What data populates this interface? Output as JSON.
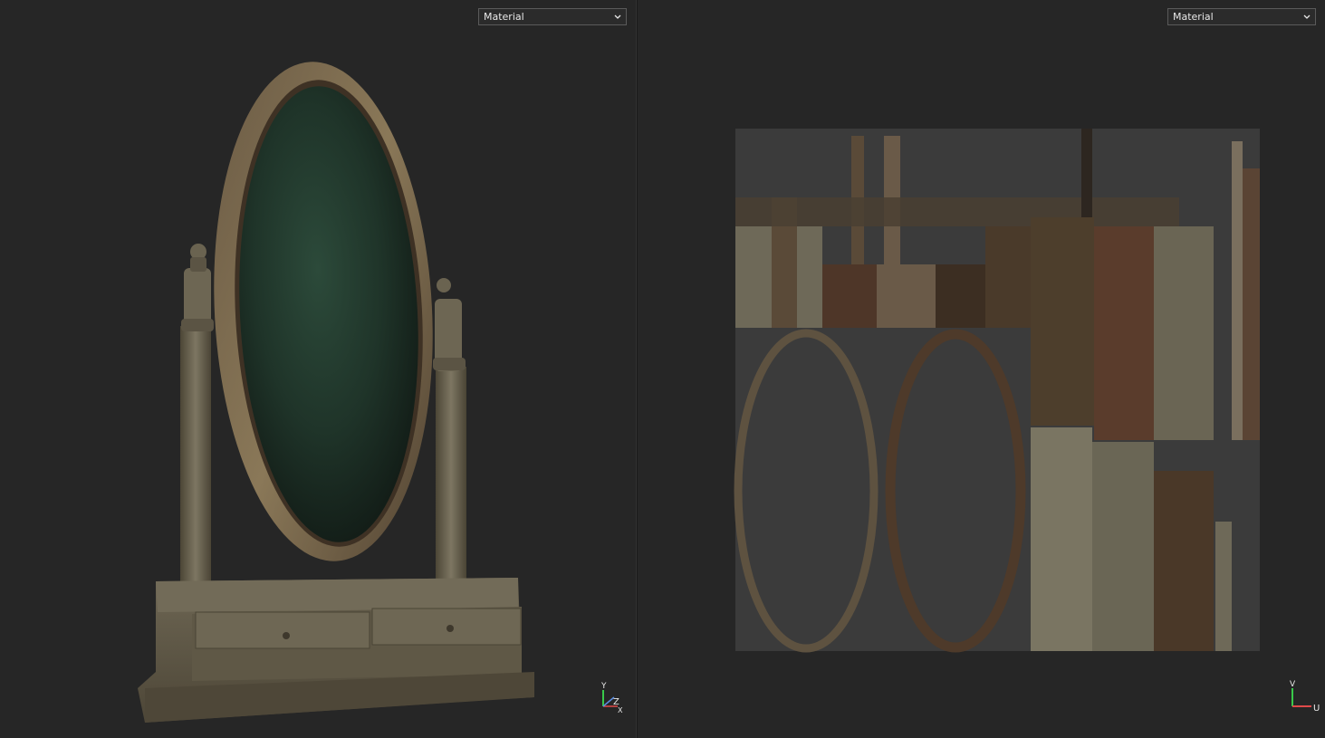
{
  "left_viewport": {
    "render_mode": "Material",
    "axis_gizmo": {
      "labels": [
        "Y",
        "Z",
        "X"
      ]
    }
  },
  "right_viewport": {
    "render_mode": "Material",
    "axis_gizmo": {
      "labels": [
        "V",
        "U"
      ]
    }
  },
  "colors": {
    "background": "#262626",
    "dropdown_border": "#5a5a5a",
    "uv_canvas": "#3b3b3b",
    "wood_dark": "#4a3a2a",
    "wood_light": "#7a7461",
    "mirror_glass": "#1e3328",
    "axis_y": "#39c94a",
    "axis_z": "#5a8ce0",
    "axis_x": "#e04a4a"
  },
  "icons": [
    "chevron-down-icon",
    "axis-gizmo-icon",
    "uv-axis-gizmo-icon"
  ]
}
